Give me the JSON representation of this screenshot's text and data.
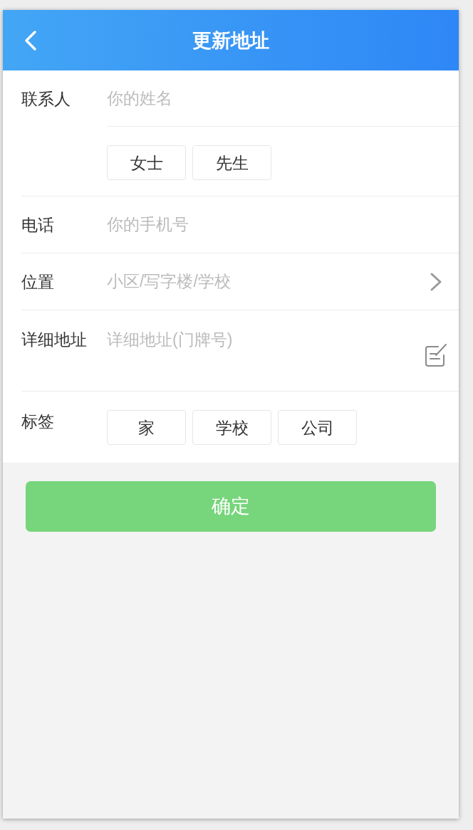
{
  "header": {
    "title": "更新地址"
  },
  "form": {
    "rows": [
      {
        "kind": "input",
        "label": "联系人",
        "placeholder": "你的姓名",
        "options": [
          {
            "label": "女士",
            "selected": false
          },
          {
            "label": "先生",
            "selected": false
          }
        ]
      },
      {
        "kind": "input",
        "label": "电话",
        "placeholder": "你的手机号"
      },
      {
        "kind": "picker",
        "label": "位置",
        "placeholder": "小区/写字楼/学校"
      },
      {
        "kind": "textarea",
        "label": "详细地址",
        "placeholder": "详细地址(门牌号)"
      },
      {
        "kind": "chips",
        "label": "标签",
        "options": [
          {
            "label": "家",
            "selected": false
          },
          {
            "label": "学校",
            "selected": false
          },
          {
            "label": "公司",
            "selected": false
          }
        ]
      }
    ]
  },
  "submit": {
    "label": "确定"
  }
}
